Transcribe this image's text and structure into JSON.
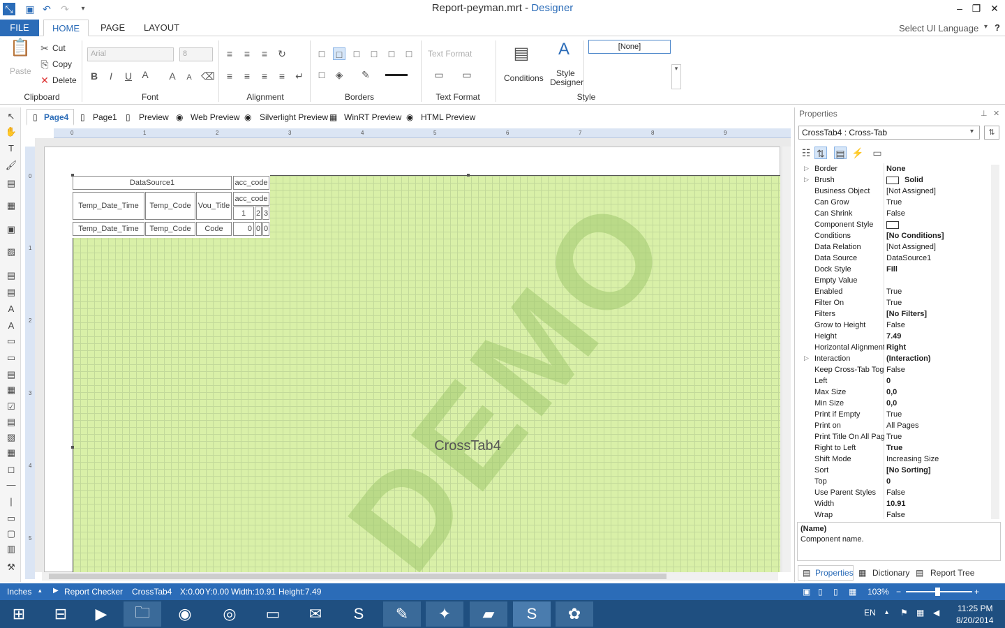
{
  "window": {
    "file_name": "Report-peyman.mrt",
    "separator": " - ",
    "app_name": "Designer"
  },
  "quick_access": {
    "icons": [
      "app-logo-icon",
      "save-icon",
      "undo-icon",
      "redo-icon",
      "customize-icon"
    ]
  },
  "window_controls": {
    "minimize": "–",
    "maximize": "❐",
    "close": "✕"
  },
  "ribbon_tabs": {
    "file": "FILE",
    "home": "HOME",
    "page": "PAGE",
    "layout": "LAYOUT",
    "ui_language": "Select UI Language",
    "help": "?"
  },
  "clipboard": {
    "paste": "Paste",
    "cut": "Cut",
    "copy": "Copy",
    "delete": "Delete",
    "label": "Clipboard"
  },
  "font": {
    "family": "Arial",
    "size": "8",
    "label": "Font",
    "bold": "B",
    "italic": "I",
    "underline": "U",
    "color": "A",
    "grow": "A",
    "shrink": "A"
  },
  "alignment": {
    "label": "Alignment"
  },
  "borders": {
    "label": "Borders"
  },
  "text_format": {
    "value": "Text Format",
    "label": "Text Format"
  },
  "style": {
    "conditions": "Conditions",
    "style_designer_1": "Style",
    "style_designer_2": "Designer",
    "none_value": "[None]",
    "label": "Style"
  },
  "sub_tabs": [
    "Page4",
    "Page1",
    "Preview",
    "Web Preview",
    "Silverlight Preview",
    "WinRT Preview",
    "HTML Preview"
  ],
  "ruler_h": [
    "0",
    "1",
    "2",
    "3",
    "4",
    "5",
    "6",
    "7",
    "8",
    "9"
  ],
  "ruler_v": [
    "0",
    "1",
    "2",
    "3",
    "4",
    "5"
  ],
  "crosstab": {
    "datasource": "DataSource1",
    "col_header": "acc_code",
    "col_header2": "acc_code",
    "rows": [
      "Temp_Date_Time",
      "Temp_Code",
      "Vou_Title"
    ],
    "cols": [
      "1",
      "2",
      "3"
    ],
    "totals_row": [
      "Temp_Date_Time",
      "Temp_Code",
      "Code"
    ],
    "totals_vals": [
      "0",
      "0",
      "0"
    ],
    "name": "CrossTab4",
    "watermark": "DEMO"
  },
  "properties": {
    "title": "Properties",
    "selected": "CrossTab4 : Cross-Tab",
    "rows": [
      {
        "k": "Border",
        "v": "None",
        "b": true,
        "exp": true
      },
      {
        "k": "Brush",
        "v": "Solid",
        "b": true,
        "exp": true,
        "swatch": true
      },
      {
        "k": "Business Object",
        "v": "[Not Assigned]",
        "b": false
      },
      {
        "k": "Can Grow",
        "v": "True",
        "b": false
      },
      {
        "k": "Can Shrink",
        "v": "False",
        "b": false
      },
      {
        "k": "Component Style",
        "v": "",
        "b": false,
        "swatch": true
      },
      {
        "k": "Conditions",
        "v": "[No Conditions]",
        "b": true
      },
      {
        "k": "Data Relation",
        "v": "[Not Assigned]",
        "b": false
      },
      {
        "k": "Data Source",
        "v": "DataSource1",
        "b": false
      },
      {
        "k": "Dock Style",
        "v": "Fill",
        "b": true
      },
      {
        "k": "Empty Value",
        "v": "",
        "b": false
      },
      {
        "k": "Enabled",
        "v": "True",
        "b": false
      },
      {
        "k": "Filter On",
        "v": "True",
        "b": false
      },
      {
        "k": "Filters",
        "v": "[No Filters]",
        "b": true
      },
      {
        "k": "Grow to Height",
        "v": "False",
        "b": false
      },
      {
        "k": "Height",
        "v": "7.49",
        "b": true
      },
      {
        "k": "Horizontal Alignment",
        "v": "Right",
        "b": true
      },
      {
        "k": "Interaction",
        "v": "(Interaction)",
        "b": true,
        "exp": true
      },
      {
        "k": "Keep Cross-Tab Tog",
        "v": "False",
        "b": false
      },
      {
        "k": "Left",
        "v": "0",
        "b": true
      },
      {
        "k": "Max Size",
        "v": "0,0",
        "b": true
      },
      {
        "k": "Min Size",
        "v": "0,0",
        "b": true
      },
      {
        "k": "Print if Empty",
        "v": "True",
        "b": false
      },
      {
        "k": "Print on",
        "v": "All Pages",
        "b": false
      },
      {
        "k": "Print Title On All Page",
        "v": "True",
        "b": false
      },
      {
        "k": "Right to Left",
        "v": "True",
        "b": true
      },
      {
        "k": "Shift Mode",
        "v": "Increasing Size",
        "b": false
      },
      {
        "k": "Sort",
        "v": "[No Sorting]",
        "b": true
      },
      {
        "k": "Top",
        "v": "0",
        "b": true
      },
      {
        "k": "Use Parent Styles",
        "v": "False",
        "b": false
      },
      {
        "k": "Width",
        "v": "10.91",
        "b": true
      },
      {
        "k": "Wrap",
        "v": "False",
        "b": false
      }
    ],
    "desc_title": "(Name)",
    "desc_text": "Component name.",
    "tabs": [
      "Properties",
      "Dictionary",
      "Report Tree"
    ]
  },
  "status": {
    "units": "Inches",
    "checker": "Report Checker",
    "component": "CrossTab4",
    "x": "X:0.00",
    "y": "Y:0.00",
    "width": "Width:10.91",
    "height": "Height:7.49",
    "zoom": "103%"
  },
  "taskbar": {
    "lang": "EN",
    "time": "11:25 PM",
    "date": "8/20/2014"
  }
}
